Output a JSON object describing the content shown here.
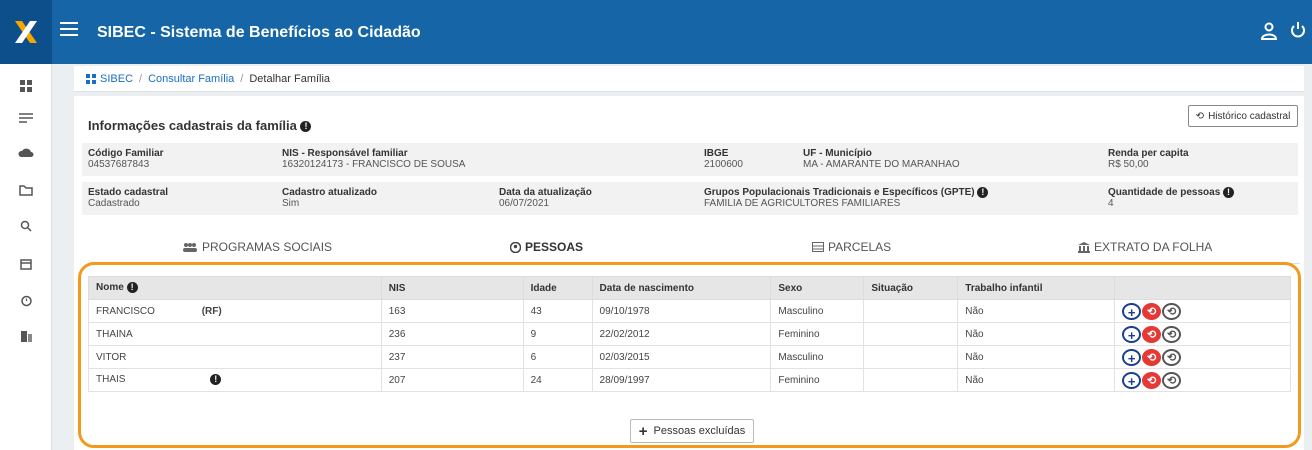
{
  "header": {
    "title": "SIBEC - Sistema de Benefícios ao Cidadão",
    "brand_color": "#1565a7"
  },
  "sidebar": {
    "items": [
      {
        "icon": "dashboard-icon"
      },
      {
        "icon": "list-icon"
      },
      {
        "icon": "cloud-upload-icon"
      },
      {
        "icon": "folder-icon"
      },
      {
        "icon": "search-icon"
      },
      {
        "icon": "calendar-icon"
      },
      {
        "icon": "alarm-icon"
      },
      {
        "icon": "building-icon"
      }
    ]
  },
  "breadcrumb": {
    "home": "SIBEC",
    "level1": "Consultar Família",
    "current": "Detalhar Família",
    "separator": "/"
  },
  "family": {
    "section_title": "Informações cadastrais da família",
    "history_button": "Histórico cadastral",
    "fields": {
      "codigo_label": "Código Familiar",
      "codigo_value": "04537687843",
      "nis_label": "NIS - Responsável familiar",
      "nis_value": "16320124173 - FRANCISCO DE SOUSA",
      "ibge_label": "IBGE",
      "ibge_value": "2100600",
      "uf_label": "UF - Município",
      "uf_value": "MA - AMARANTE DO MARANHAO",
      "renda_label": "Renda per capita",
      "renda_value": "R$ 50,00",
      "estado_label": "Estado cadastral",
      "estado_value": "Cadastrado",
      "atualizado_label": "Cadastro atualizado",
      "atualizado_value": "Sim",
      "data_label": "Data da atualização",
      "data_value": "06/07/2021",
      "gpte_label": "Grupos Populacionais Tradicionais e Específicos (GPTE)",
      "gpte_value": "FAMILIA DE AGRICULTORES FAMILIARES",
      "qtd_label": "Quantidade de pessoas",
      "qtd_value": "4"
    }
  },
  "tabs": [
    {
      "label": "PROGRAMAS SOCIAIS"
    },
    {
      "label": "PESSOAS"
    },
    {
      "label": "PARCELAS"
    },
    {
      "label": "EXTRATO DA FOLHA"
    }
  ],
  "people_table": {
    "headers": [
      "Nome",
      "NIS",
      "Idade",
      "Data de nascimento",
      "Sexo",
      "Situação",
      "Trabalho infantil",
      ""
    ],
    "rows": [
      {
        "nome": "FRANCISCO",
        "suffix": "(RF)",
        "nis": "163",
        "idade": "43",
        "nasc": "09/10/1978",
        "sexo": "Masculino",
        "situacao": "",
        "trabalho": "Não"
      },
      {
        "nome": "THAINA",
        "suffix": "",
        "nis": "236",
        "idade": "9",
        "nasc": "22/02/2012",
        "sexo": "Feminino",
        "situacao": "",
        "trabalho": "Não"
      },
      {
        "nome": "VITOR",
        "suffix": "",
        "nis": "237",
        "idade": "6",
        "nasc": "02/03/2015",
        "sexo": "Masculino",
        "situacao": "",
        "trabalho": "Não"
      },
      {
        "nome": "THAIS",
        "suffix": "",
        "nis": "207",
        "idade": "24",
        "nasc": "28/09/1997",
        "sexo": "Feminino",
        "situacao": "",
        "trabalho": "Não"
      }
    ]
  },
  "excluded_button": "Pessoas excluídas",
  "colors": {
    "highlight": "#f29a1e",
    "action_blue": "#1a3f8c",
    "action_red": "#e53935"
  }
}
